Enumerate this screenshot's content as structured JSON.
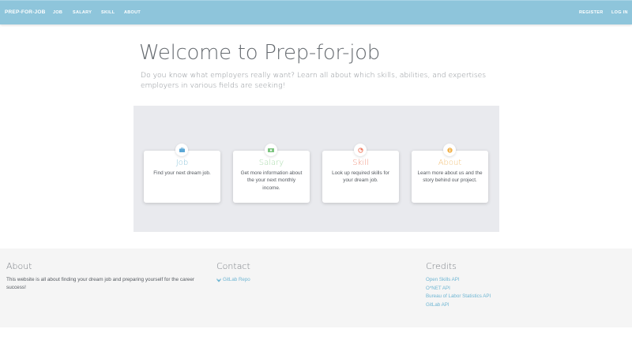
{
  "navbar": {
    "brand": "PREP-FOR-JOB",
    "links": [
      "JOB",
      "SALARY",
      "SKILL",
      "ABOUT"
    ],
    "register": "REGISTER",
    "login": "LOG IN"
  },
  "hero": {
    "title": "Welcome to Prep-for-job",
    "subtitle": "Do you know what employers really want? Learn all about which skills, abilities, and expertises employers in various fields are seeking!"
  },
  "cards": [
    {
      "title": "Job",
      "text": "Find your next dream job.",
      "icon": "briefcase-icon",
      "color": "#8ec5db"
    },
    {
      "title": "Salary",
      "text": "Get more information about the your next monthly income.",
      "icon": "money-icon",
      "color": "#a6d9a8"
    },
    {
      "title": "Skill",
      "text": "Look up required skills for your dream job.",
      "icon": "chart-icon",
      "color": "#f0907b"
    },
    {
      "title": "About",
      "text": "Learn more about us and the story behind our project.",
      "icon": "info-icon",
      "color": "#f2c27a"
    }
  ],
  "footer": {
    "about_heading": "About",
    "about_text": "This website is all about finding your dream job and preparing yourself for the career success!",
    "contact_heading": "Contact",
    "contact_link": "GitLab Repo",
    "credits_heading": "Credits",
    "credits": [
      "Open Skills API",
      "O*NET API",
      "Bureau of Labor Statistics API",
      "GitLab API"
    ]
  },
  "colors": {
    "navbar": "#8ec5db",
    "panel": "#e9eaee",
    "footer": "#f5f5f5",
    "link": "#6fb6d3"
  }
}
